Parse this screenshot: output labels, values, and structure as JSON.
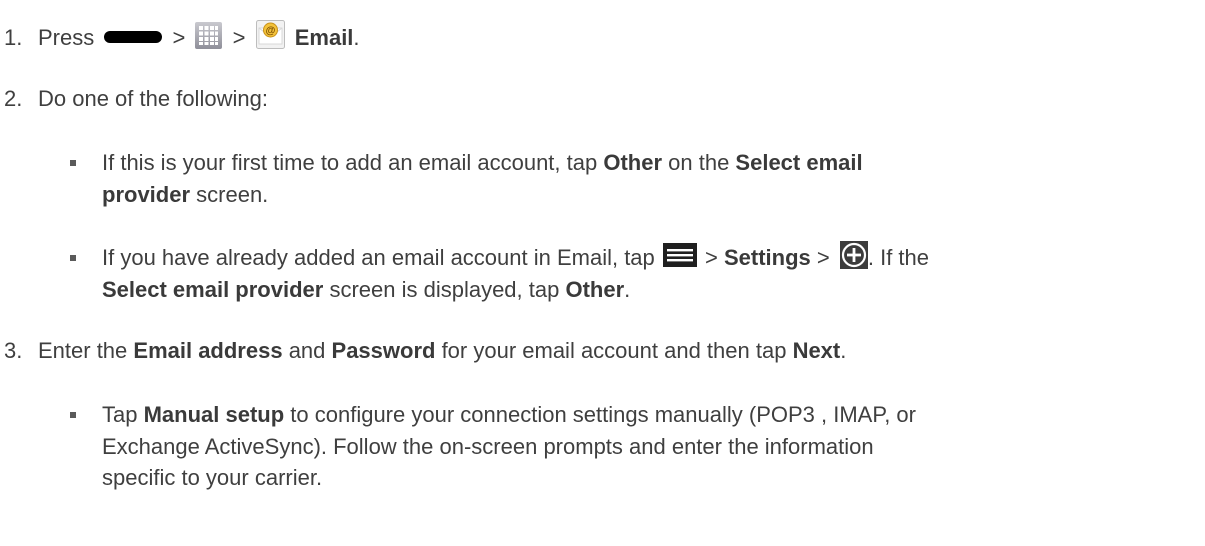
{
  "step1": {
    "number": "1.",
    "press": "Press",
    "sep1": ">",
    "sep2": ">",
    "email": "Email",
    "period": "."
  },
  "step2": {
    "number": "2.",
    "text": "Do one of the following:",
    "bullet1": {
      "t1": "If this is your first time to add an email account, tap ",
      "other": "Other",
      "t2": " on the ",
      "select": "Select email",
      "provider": "provider",
      "t3": " screen."
    },
    "bullet2": {
      "t1": "If you have already added an email account in Email, tap ",
      "sep1": " > ",
      "settings": "Settings",
      "sep2": " > ",
      "t2": ". If the",
      "select": "Select email provider",
      "t3": " screen is displayed, tap ",
      "other": "Other",
      "period": "."
    }
  },
  "step3": {
    "number": "3.",
    "t1": "Enter the ",
    "email_address": "Email address",
    "t2": " and ",
    "password": "Password",
    "t3": " for your email account and then tap ",
    "next": "Next",
    "period": ".",
    "bullet1": {
      "t1": "Tap ",
      "manual": "Manual setup",
      "t2": " to configure your connection settings manually (POP3 , IMAP, or",
      "line2": "Exchange ActiveSync). Follow the on-screen prompts and enter the information",
      "line3": "specific to your carrier."
    }
  },
  "icons": {
    "home": "home-key-icon",
    "apps": "apps-grid-icon",
    "email": "email-app-icon",
    "menu": "menu-icon",
    "add": "add-circle-icon"
  }
}
